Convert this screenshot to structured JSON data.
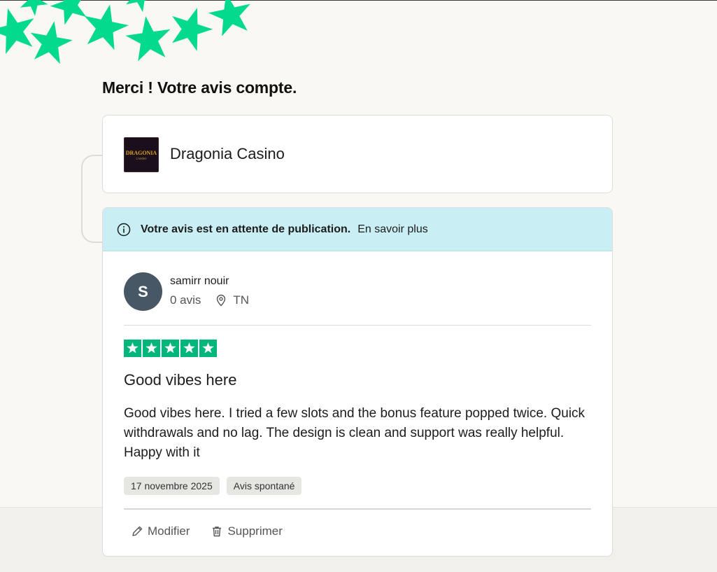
{
  "page": {
    "title": "Merci ! Votre avis compte."
  },
  "business": {
    "name": "Dragonia Casino",
    "logo_text": "DRAGONIA",
    "logo_subtext": "CASINO"
  },
  "notice": {
    "message": "Votre avis est en attente de publication.",
    "link_label": "En savoir plus",
    "icon": "info-icon"
  },
  "reviewer": {
    "initial": "S",
    "name": "samirr nouir",
    "review_count": "0 avis",
    "country": "TN"
  },
  "review": {
    "rating": 5,
    "title": "Good vibes here",
    "body": "Good vibes here. I tried a few slots and the bonus feature popped twice. Quick withdrawals and no lag. The design is clean and support was really helpful. Happy with it",
    "date": "17 novembre 2025",
    "source": "Avis spontané"
  },
  "actions": {
    "edit_label": "Modifier",
    "delete_label": "Supprimer"
  },
  "colors": {
    "accent_green": "#00b67a",
    "deco_green": "#04da8d",
    "notice_bg": "#c9eef4",
    "avatar_bg": "#475766"
  }
}
